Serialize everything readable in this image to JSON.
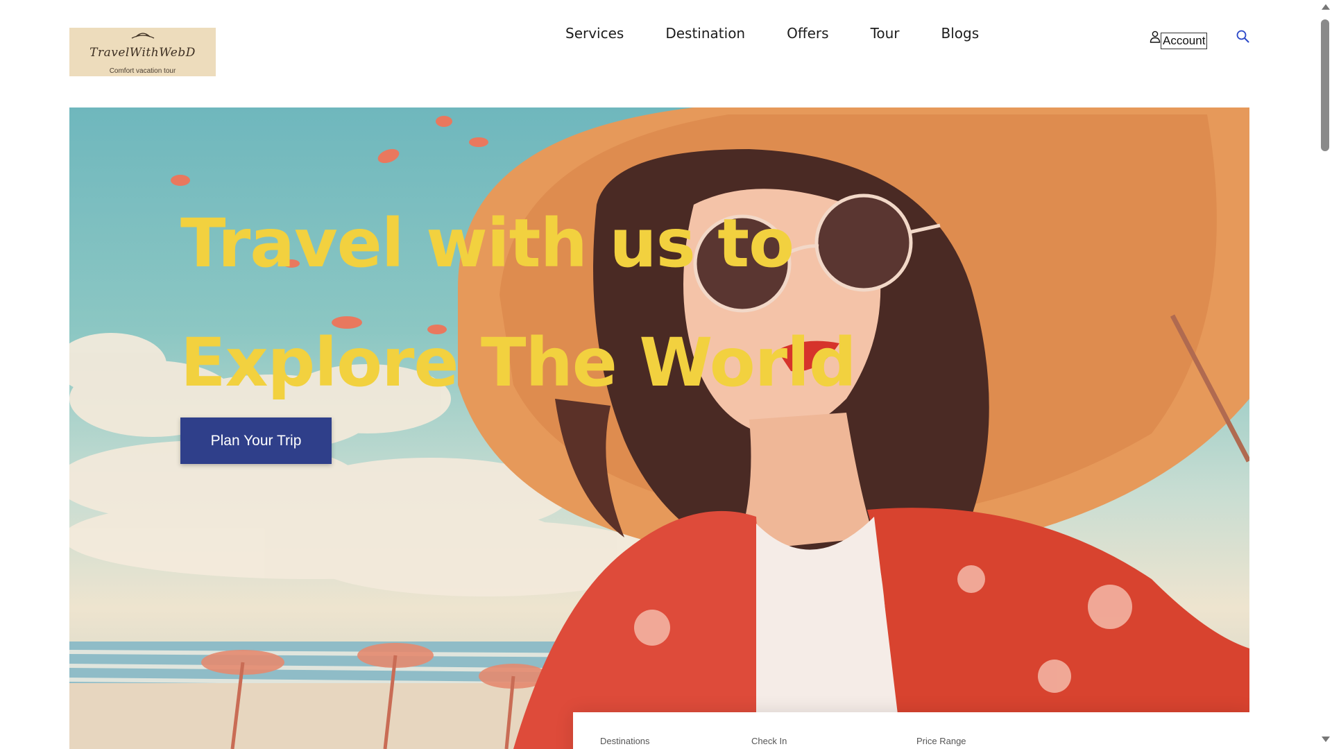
{
  "logo": {
    "name": "TravelWithWebD",
    "tagline": "Comfort vacation tour"
  },
  "nav": {
    "items": [
      {
        "label": "Services"
      },
      {
        "label": "Destination"
      },
      {
        "label": "Offers"
      },
      {
        "label": "Tour"
      },
      {
        "label": "Blogs"
      }
    ]
  },
  "header": {
    "account_label": "Account",
    "icons": [
      "user-icon",
      "search-icon"
    ]
  },
  "hero": {
    "title_line1": "Travel with us to",
    "title_line2": "Explore The World",
    "cta_label": "Plan Your Trip",
    "title_color": "#f2d13f",
    "cta_color": "#2f3f8a"
  },
  "search": {
    "fields": [
      {
        "label": "Destinations"
      },
      {
        "label": "Check In"
      },
      {
        "label": "Price Range"
      }
    ]
  }
}
